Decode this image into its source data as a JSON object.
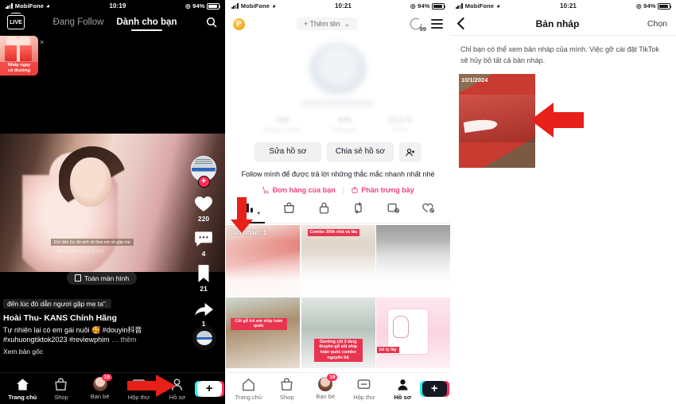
{
  "panel1": {
    "status": {
      "carrier": "MobiFone",
      "time": "10:19",
      "battery": "94%"
    },
    "header": {
      "live_label": "LIVE",
      "tab_following": "Đang Follow",
      "tab_foryou": "Dành cho bạn",
      "search_icon": "search-icon"
    },
    "promo": {
      "line1": "Nhấp ngay",
      "line2": "có thưởng",
      "close": "×"
    },
    "video": {
      "subtitle": "Đợi đến lúc đó anh sẽ đưa em về gặp mẹ",
      "subtitle_cn": "到时候我带你回去见我妈",
      "fullscreen_label": "Toàn màn hình",
      "caption_tag": "đến lúc đó dẫn ngươi gặp mẹ ta\".",
      "username": "Hoài Thu- KANS Chính Hãng",
      "description": "Tự nhiên lại có em gái nuôi 🥰 #douyin抖音 #xuhuongtiktok2023 #reviewphim",
      "more": "… thêm",
      "original": "Xem bản gốc"
    },
    "rail": {
      "likes": "220",
      "comments": "4",
      "bookmarks": "21",
      "shares": "1"
    },
    "tabbar": [
      {
        "label": "Trang chủ",
        "icon": "home-icon",
        "active": true
      },
      {
        "label": "Shop",
        "icon": "shop-bag-icon",
        "active": false
      },
      {
        "label": "Bạn bè",
        "icon": "friends-avatar-icon",
        "badge": "19",
        "active": false
      },
      {
        "label": "Hộp thư",
        "icon": "inbox-icon",
        "active": false
      },
      {
        "label": "Hồ sơ",
        "icon": "profile-person-icon",
        "active": false
      }
    ],
    "create_button": "+"
  },
  "panel2": {
    "status": {
      "carrier": "MobiFone",
      "time": "10:21",
      "battery": "94%"
    },
    "header": {
      "coin_icon": "P",
      "add_name": "+ Thêm tên",
      "chevron": "⌄",
      "notif_count": "99",
      "menu_icon": "hamburger-menu-icon"
    },
    "stats": [
      {
        "value": "150",
        "label": "Đang Follow"
      },
      {
        "value": "906",
        "label": "Follower"
      },
      {
        "value": "22,8 N",
        "label": "Thích"
      }
    ],
    "buttons": {
      "edit_profile": "Sửa hồ sơ",
      "share_profile": "Chia sẻ hồ sơ",
      "add_friend": "add-person-icon"
    },
    "bio": "Follow mình để được trả lời những thắc mắc nhanh nhất nhé",
    "shop_links": [
      {
        "label": "Đơn hàng của bạn",
        "icon": "cart-icon"
      },
      {
        "label": "Phần trưng bày",
        "icon": "shop-lock-icon"
      }
    ],
    "tabs": [
      {
        "icon": "grid-bars-icon",
        "active": true
      },
      {
        "icon": "shop-bag-icon",
        "active": false
      },
      {
        "icon": "lock-icon",
        "active": false
      },
      {
        "icon": "repost-icon",
        "active": false
      },
      {
        "icon": "hidden-video-icon",
        "active": false
      },
      {
        "icon": "hidden-liked-icon",
        "active": false
      }
    ],
    "draft_tag": "Bản nháp: 1",
    "grid": [
      {
        "overlay": "",
        "views": ""
      },
      {
        "overlay": "Combo 300k  nhà và lâu",
        "views": ""
      },
      {
        "overlay": "",
        "views": ""
      },
      {
        "overlay": "Cũi gỗ trẻ em ship toàn quốc",
        "views": ""
      },
      {
        "overlay": "Giường cũi 3 tầng thuyền gỗ sồi ship toàn quốc combo nguyên bộ",
        "views": ""
      },
      {
        "overlay": "bé ty lấy",
        "views": ""
      }
    ],
    "tabbar": [
      {
        "label": "Trang chủ",
        "icon": "home-icon",
        "active": false
      },
      {
        "label": "Shop",
        "icon": "shop-bag-icon",
        "active": false
      },
      {
        "label": "Bạn bè",
        "icon": "friends-avatar-icon",
        "badge": "19",
        "active": false
      },
      {
        "label": "Hộp thư",
        "icon": "inbox-icon",
        "active": false
      },
      {
        "label": "Hồ sơ",
        "icon": "profile-person-icon",
        "active": true
      }
    ],
    "create_button": "+"
  },
  "panel3": {
    "status": {
      "carrier": "MobiFone",
      "time": "10:21",
      "battery": "94%"
    },
    "header": {
      "back_icon": "back-chevron-icon",
      "title": "Bản nháp",
      "action": "Chọn"
    },
    "note": "Chỉ bạn có thể xem bản nháp của mình. Việc gỡ cài đặt TikTok sẽ hủy bỏ tất cả bản nháp.",
    "draft": {
      "date": "10/1/2024"
    }
  },
  "annotations": [
    {
      "name": "arrow-to-profile-tab",
      "direction": "right"
    },
    {
      "name": "arrow-to-drafts-tab",
      "direction": "down"
    },
    {
      "name": "arrow-to-draft-thumbnail",
      "direction": "left"
    }
  ],
  "colors": {
    "accent_pink": "#fe2c55",
    "accent_cyan": "#25f4ee",
    "arrow_red": "#e8201a",
    "shop_pink": "#f0447a"
  }
}
